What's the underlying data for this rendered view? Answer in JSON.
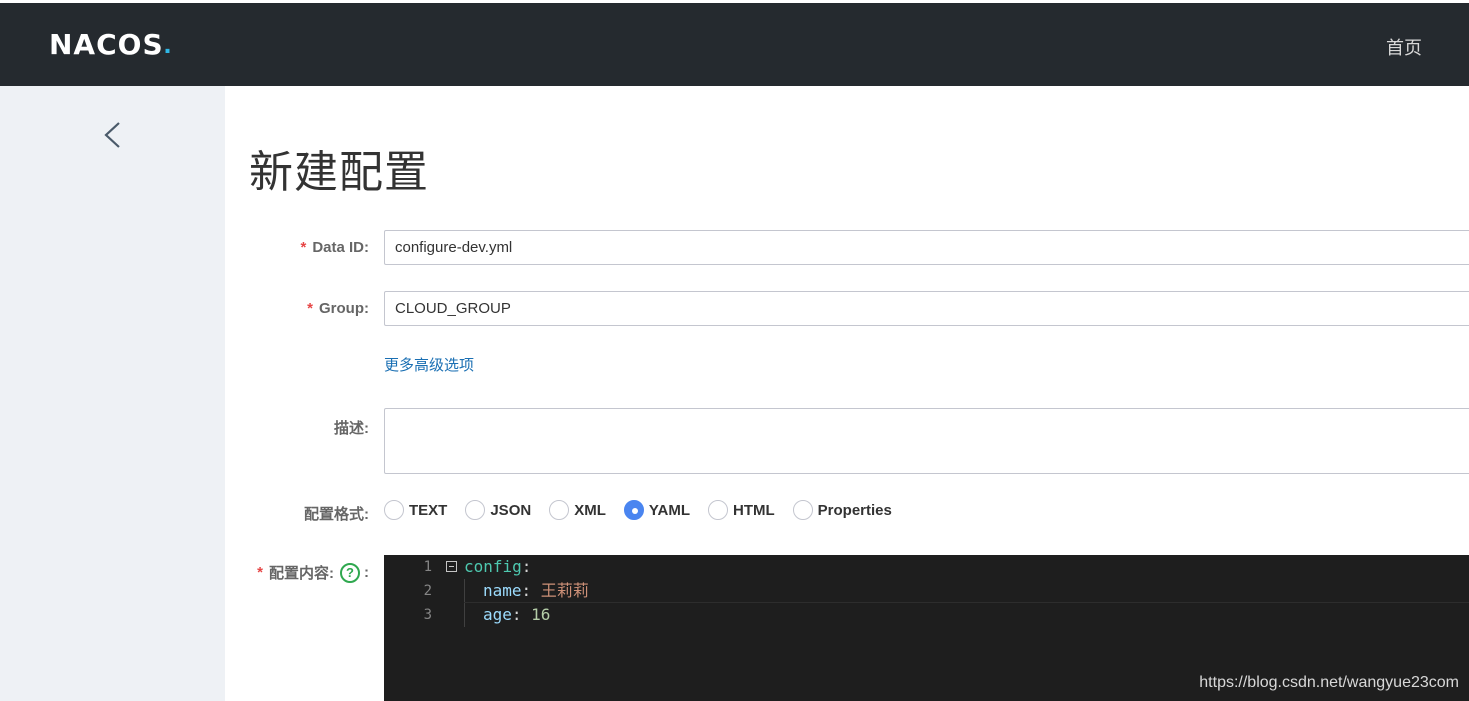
{
  "header": {
    "logo_main": "NACOS",
    "logo_dot": ".",
    "nav_home": "首页"
  },
  "page": {
    "title": "新建配置"
  },
  "form": {
    "data_id": {
      "label": "Data ID:",
      "required": "*",
      "value": "configure-dev.yml"
    },
    "group": {
      "label": "Group:",
      "required": "*",
      "value": "CLOUD_GROUP"
    },
    "more_options": "更多高级选项",
    "description": {
      "label": "描述:",
      "value": ""
    },
    "format": {
      "label": "配置格式:",
      "options": [
        "TEXT",
        "JSON",
        "XML",
        "YAML",
        "HTML",
        "Properties"
      ],
      "selected": "YAML"
    },
    "content": {
      "label": "配置内容:",
      "required": "*",
      "help": "?",
      "colon": ":",
      "lines": [
        {
          "num": "1",
          "key": "config",
          "sep": ":",
          "value": ""
        },
        {
          "num": "2",
          "key": "name",
          "sep": ": ",
          "value": "王莉莉"
        },
        {
          "num": "3",
          "key": "age",
          "sep": ": ",
          "value": "16"
        }
      ]
    }
  },
  "watermark": "https://blog.csdn.net/wangyue23com"
}
